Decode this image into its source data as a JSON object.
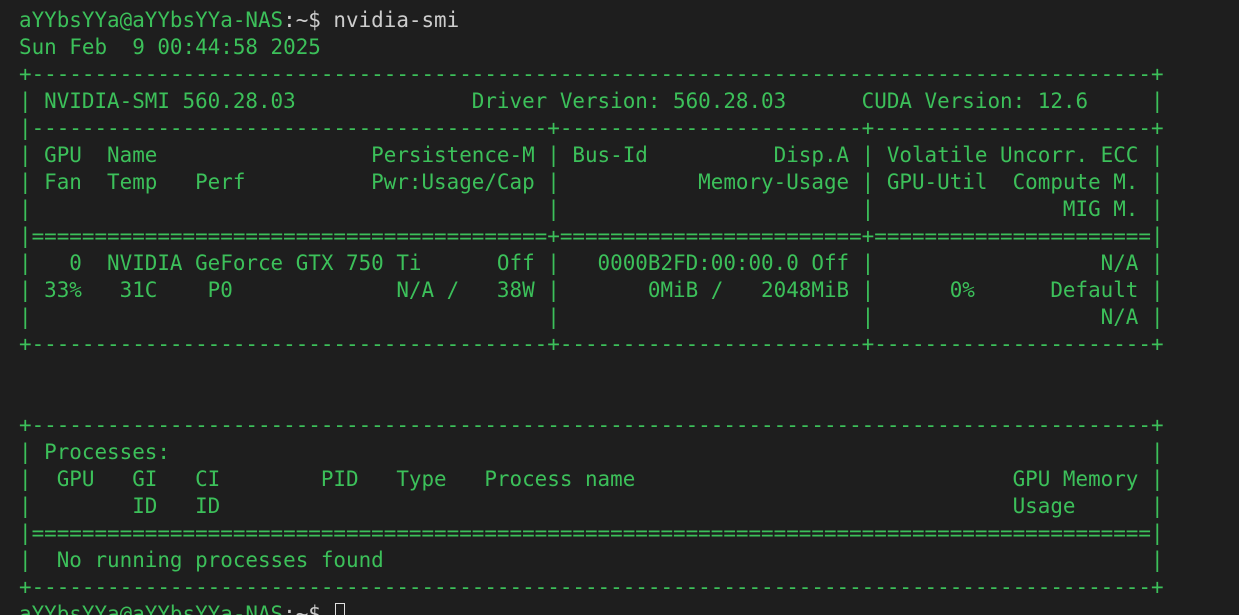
{
  "terminal": {
    "prompt_user_host": "aYYbsYYa@aYYbsYYa-NAS",
    "prompt_path": ":~$",
    "command": "nvidia-smi",
    "timestamp": "Sun Feb  9 00:44:58 2025"
  },
  "lines": [
    {
      "name": "line-top-border-prev",
      "segments": [
        {
          "c": "g",
          "t": "+-----------------------------------------------------------------------------------------+"
        }
      ]
    },
    {
      "name": "prompt-line-command",
      "segments": [
        {
          "c": "g",
          "t": "aYYbsYYa@aYYbsYYa-NAS"
        },
        {
          "c": "w",
          "t": ":~$ nvidia-smi"
        }
      ]
    },
    {
      "name": "timestamp-line",
      "segments": [
        {
          "c": "g",
          "t": "Sun Feb  9 00:44:58 2025"
        }
      ]
    },
    {
      "name": "header-top-border",
      "segments": [
        {
          "c": "g",
          "t": "+-----------------------------------------------------------------------------------------+"
        }
      ]
    },
    {
      "name": "version-line",
      "segments": [
        {
          "c": "g",
          "t": "| NVIDIA-SMI 560.28.03              Driver Version: 560.28.03      CUDA Version: 12.6     |"
        }
      ]
    },
    {
      "name": "header-sep-1",
      "segments": [
        {
          "c": "g",
          "t": "|-----------------------------------------+------------------------+----------------------+"
        }
      ]
    },
    {
      "name": "column-header-1",
      "segments": [
        {
          "c": "g",
          "t": "| GPU  Name                 Persistence-M | Bus-Id          Disp.A | Volatile Uncorr. ECC |"
        }
      ]
    },
    {
      "name": "column-header-2",
      "segments": [
        {
          "c": "g",
          "t": "| Fan  Temp   Perf          Pwr:Usage/Cap |           Memory-Usage | GPU-Util  Compute M. |"
        }
      ]
    },
    {
      "name": "column-header-3",
      "segments": [
        {
          "c": "g",
          "t": "|                                         |                        |               MIG M. |"
        }
      ]
    },
    {
      "name": "header-double-sep",
      "segments": [
        {
          "c": "g",
          "t": "|=========================================+========================+======================|"
        }
      ]
    },
    {
      "name": "gpu-row-1",
      "segments": [
        {
          "c": "g",
          "t": "|   0  NVIDIA GeForce GTX 750 Ti      Off |   0000B2FD:00:00.0 Off |                  N/A |"
        }
      ]
    },
    {
      "name": "gpu-row-2",
      "segments": [
        {
          "c": "g",
          "t": "| 33%   31C    P0             N/A /   38W |       0MiB /   2048MiB |      0%      Default |"
        }
      ]
    },
    {
      "name": "gpu-row-3",
      "segments": [
        {
          "c": "g",
          "t": "|                                         |                        |                  N/A |"
        }
      ]
    },
    {
      "name": "gpu-table-bottom-border",
      "segments": [
        {
          "c": "g",
          "t": "+-----------------------------------------+------------------------+----------------------+"
        }
      ]
    },
    {
      "name": "blank-line-1",
      "segments": [
        {
          "c": "g",
          "t": " "
        }
      ]
    },
    {
      "name": "blank-line-2",
      "segments": [
        {
          "c": "g",
          "t": " "
        }
      ]
    },
    {
      "name": "processes-top-border",
      "segments": [
        {
          "c": "g",
          "t": "+-----------------------------------------------------------------------------------------+"
        }
      ]
    },
    {
      "name": "processes-title",
      "segments": [
        {
          "c": "g",
          "t": "| Processes:                                                                              |"
        }
      ]
    },
    {
      "name": "processes-header-1",
      "segments": [
        {
          "c": "g",
          "t": "|  GPU   GI   CI        PID   Type   Process name                              GPU Memory |"
        }
      ]
    },
    {
      "name": "processes-header-2",
      "segments": [
        {
          "c": "g",
          "t": "|        ID   ID                                                               Usage      |"
        }
      ]
    },
    {
      "name": "processes-double-sep",
      "segments": [
        {
          "c": "g",
          "t": "|=========================================================================================|"
        }
      ]
    },
    {
      "name": "no-processes-message",
      "segments": [
        {
          "c": "g",
          "t": "|  No running processes found                                                             |"
        }
      ]
    },
    {
      "name": "processes-bottom-border",
      "segments": [
        {
          "c": "g",
          "t": "+-----------------------------------------------------------------------------------------+"
        }
      ]
    }
  ],
  "final_prompt": {
    "user_host": "aYYbsYYa@aYYbsYYa-NAS",
    "path": ":~$ "
  }
}
